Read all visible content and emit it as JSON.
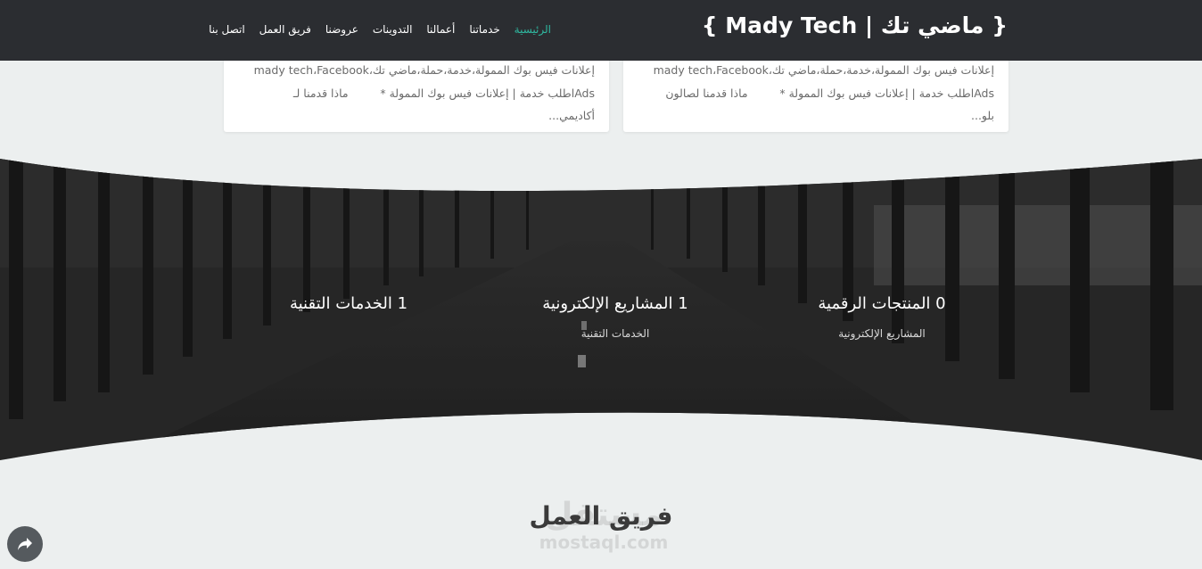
{
  "header": {
    "brand": "{ Mady Tech | ماضي تك }",
    "nav": [
      {
        "label": "الرئيسية",
        "active": true
      },
      {
        "label": "خدماتنا",
        "active": false
      },
      {
        "label": "أعمالنا",
        "active": false
      },
      {
        "label": "التدوينات",
        "active": false
      },
      {
        "label": "عروضنا",
        "active": false
      },
      {
        "label": "فريق العمل",
        "active": false
      },
      {
        "label": "اتصل بنا",
        "active": false
      }
    ]
  },
  "posts": [
    {
      "line1": "إعلانات فيس بوك الممولة،خدمة،حملة،ماضي تك،mady tech،Facebook",
      "line2": "Adsاطلب خدمة | إعلانات فيس بوك الممولة *         ماذا قدمنا لصالون",
      "line3": "بلو..."
    },
    {
      "line1": "إعلانات فيس بوك الممولة،خدمة،حملة،ماضي تك،mady tech،Facebook",
      "line2": "Adsاطلب خدمة | إعلانات فيس بوك الممولة *         ماذا قدمنا لـ",
      "line3": "أكاديمي..."
    }
  ],
  "stats": [
    {
      "title": "0 المنتجات الرقمية",
      "sub": "المشاريع الإلكترونية"
    },
    {
      "title": "1 المشاريع الإلكترونية",
      "sub": "الخدمات التقنية"
    },
    {
      "title": "1 الخدمات التقنية",
      "sub": ""
    }
  ],
  "team": {
    "title": "فريق العمل"
  },
  "watermark": {
    "arabic": "مستقل",
    "latin": "mostaql.com"
  },
  "icons": {
    "share": "share-arrow-icon"
  },
  "colors": {
    "header_bg": "#2b2d31",
    "accent": "#2fb8a0",
    "page_bg": "#ecefef"
  }
}
